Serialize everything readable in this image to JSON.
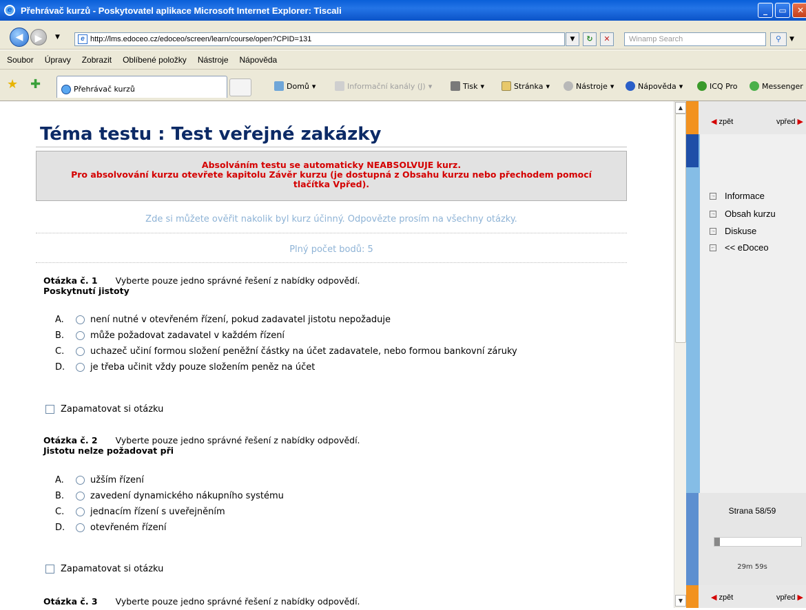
{
  "window": {
    "title": "Přehrávač kurzů - Poskytovatel aplikace Microsoft Internet Explorer: Tiscali",
    "min_label": "_",
    "max_label": "▭",
    "close_label": "✕"
  },
  "address_bar": {
    "url": "http://lms.edoceo.cz/edoceo/screen/learn/course/open?CPID=131",
    "search_placeholder": "Winamp Search"
  },
  "menu": [
    "Soubor",
    "Úpravy",
    "Zobrazit",
    "Oblíbené položky",
    "Nástroje",
    "Nápověda"
  ],
  "tab": {
    "label": "Přehrávač kurzů"
  },
  "toolbar": {
    "home": "Domů",
    "feeds": "Informační kanály (J)",
    "print": "Tisk",
    "page": "Stránka",
    "tools": "Nástroje",
    "help": "Nápověda",
    "icq": "ICQ Pro",
    "messenger": "Messenger"
  },
  "page": {
    "title": "Téma testu : Test veřejné zakázky",
    "warning_line1": "Absolváním testu se automaticky NEABSOLVUJE kurz.",
    "warning_line2": "Pro absolvování kurzu otevřete kapitolu Závěr kurzu (je dostupná z Obsahu kurzu nebo přechodem pomocí",
    "warning_line3": "tlačítka Vpřed).",
    "intro": "Zde si můžete ověřit nakolik byl kurz účinný. Odpovězte prosím na všechny otázky.",
    "points": "Plný počet bodů: 5"
  },
  "questions": [
    {
      "number": "Otázka č. 1",
      "instruction": "Vyberte pouze jedno správné řešení z nabídky odpovědí.",
      "text": "Poskytnutí jistoty",
      "options": [
        {
          "letter": "A.",
          "text": "není nutné v otevřeném řízení, pokud zadavatel jistotu nepožaduje"
        },
        {
          "letter": "B.",
          "text": "může požadovat zadavatel v každém řízení"
        },
        {
          "letter": "C.",
          "text": "uchazeč učiní formou složení peněžní částky na účet zadavatele, nebo formou bankovní záruky"
        },
        {
          "letter": "D.",
          "text": "je třeba učinit vždy pouze složením peněz na účet"
        }
      ],
      "remember": "Zapamatovat si otázku"
    },
    {
      "number": "Otázka č. 2",
      "instruction": "Vyberte pouze jedno správné řešení z nabídky odpovědí.",
      "text": "Jistotu nelze požadovat při",
      "options": [
        {
          "letter": "A.",
          "text": "užším řízení"
        },
        {
          "letter": "B.",
          "text": "zavedení dynamického nákupního systému"
        },
        {
          "letter": "C.",
          "text": "jednacím řízení s uveřejněním"
        },
        {
          "letter": "D.",
          "text": "otevřeném řízení"
        }
      ],
      "remember": "Zapamatovat si otázku"
    },
    {
      "number": "Otázka č. 3",
      "instruction": "Vyberte pouze jedno správné řešení z nabídky odpovědí."
    }
  ],
  "sidebar": {
    "back": "zpět",
    "forward": "vpřed",
    "items": [
      "Informace",
      "Obsah kurzu",
      "Diskuse",
      "<< eDoceo"
    ],
    "page_counter": "Strana 58/59",
    "progress": 0.06,
    "timer": "29m 59s"
  },
  "colors": {
    "title": "#0c2a66",
    "warning": "#d40000",
    "info": "#8eb3d6",
    "sidebar_orange": "#f2921f",
    "sidebar_blue": "#85bde6",
    "sidebar_dark_blue": "#1e4fa8"
  }
}
